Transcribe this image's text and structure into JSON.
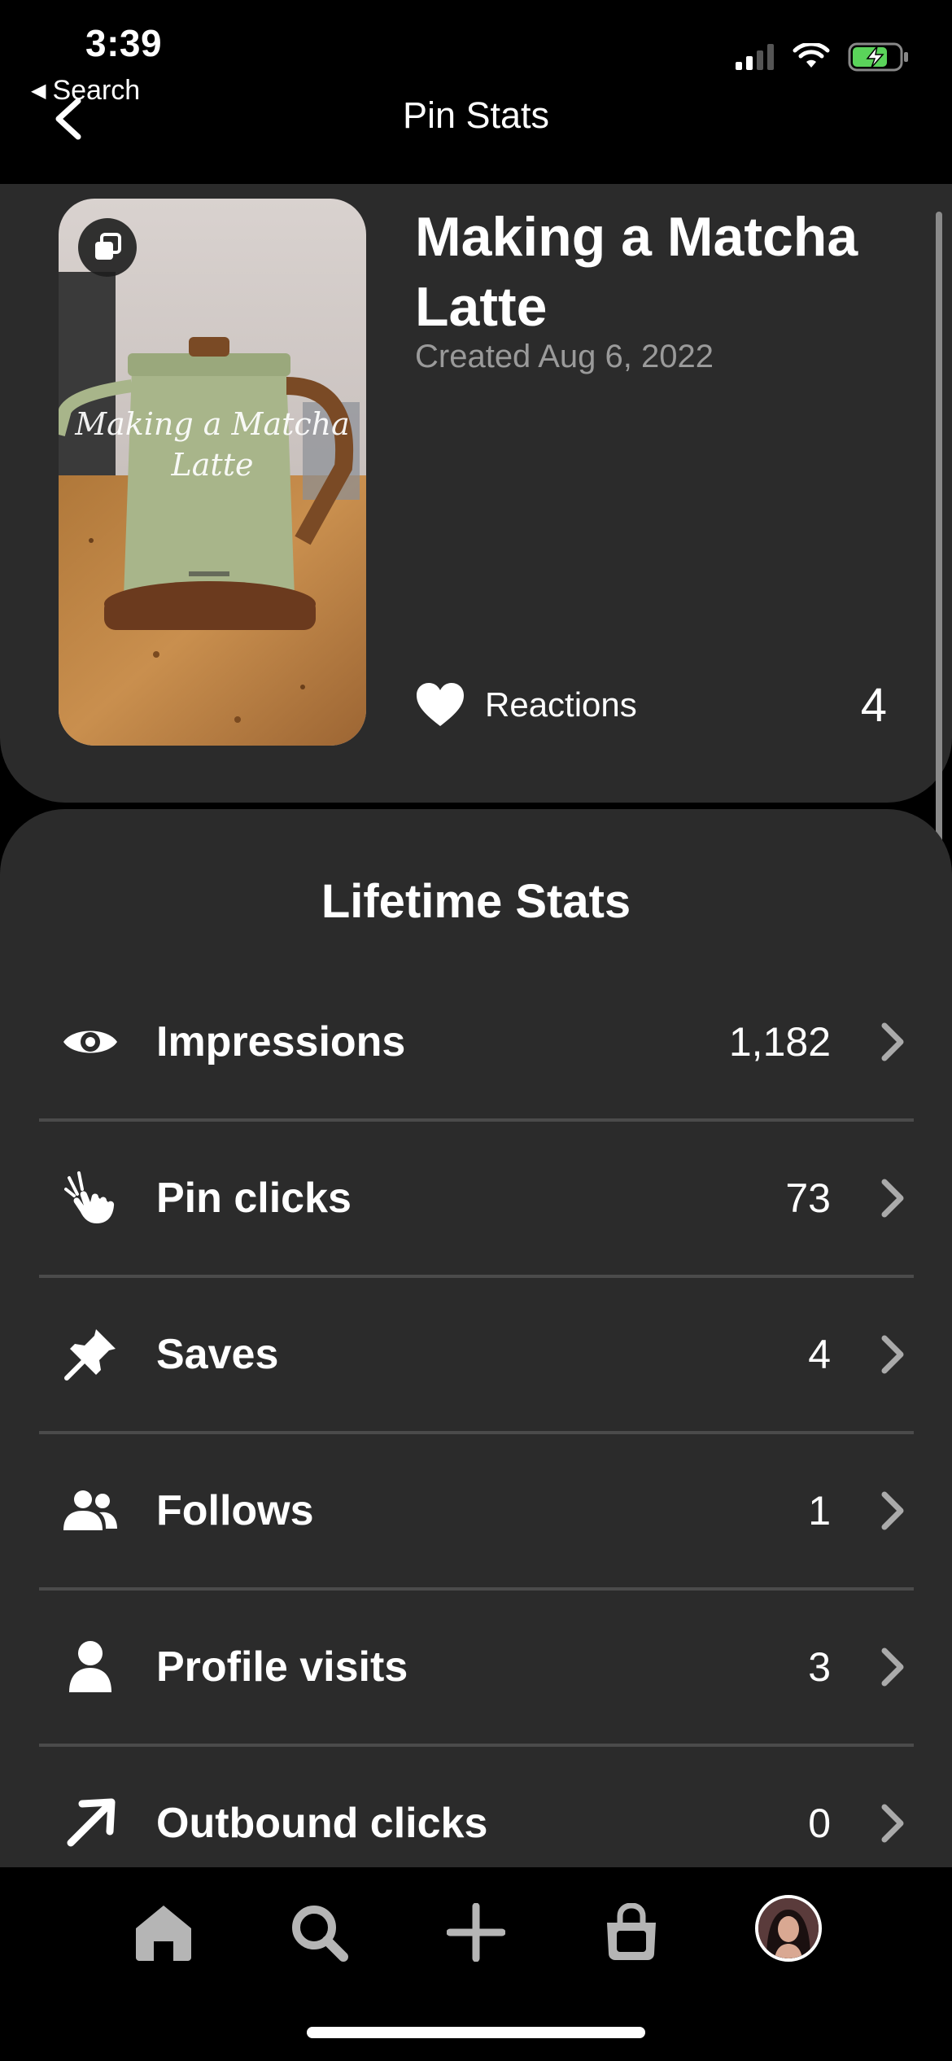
{
  "status_bar": {
    "time": "3:39",
    "back_app": "Search"
  },
  "header": {
    "title": "Pin Stats"
  },
  "pin": {
    "title": "Making a Matcha Latte",
    "thumbnail_caption": "Making a Matcha Latte",
    "created": "Created Aug 6, 2022",
    "reactions_label": "Reactions",
    "reactions_count": "4"
  },
  "lifetime_stats": {
    "title": "Lifetime Stats",
    "rows": [
      {
        "label": "Impressions",
        "value": "1,182",
        "icon": "eye-icon"
      },
      {
        "label": "Pin clicks",
        "value": "73",
        "icon": "tap-hand-icon"
      },
      {
        "label": "Saves",
        "value": "4",
        "icon": "pin-icon"
      },
      {
        "label": "Follows",
        "value": "1",
        "icon": "people-icon"
      },
      {
        "label": "Profile visits",
        "value": "3",
        "icon": "person-icon"
      },
      {
        "label": "Outbound clicks",
        "value": "0",
        "icon": "arrow-up-right-icon"
      }
    ]
  },
  "tab_bar": {
    "items": [
      "home-icon",
      "search-icon",
      "plus-icon",
      "shopping-bag-icon",
      "profile-avatar"
    ]
  },
  "colors": {
    "background": "#000000",
    "card": "#2b2b2b",
    "divider": "#4b4b4b",
    "secondary_text": "#9a9a9a",
    "tab_icon": "#b5b5b5"
  }
}
